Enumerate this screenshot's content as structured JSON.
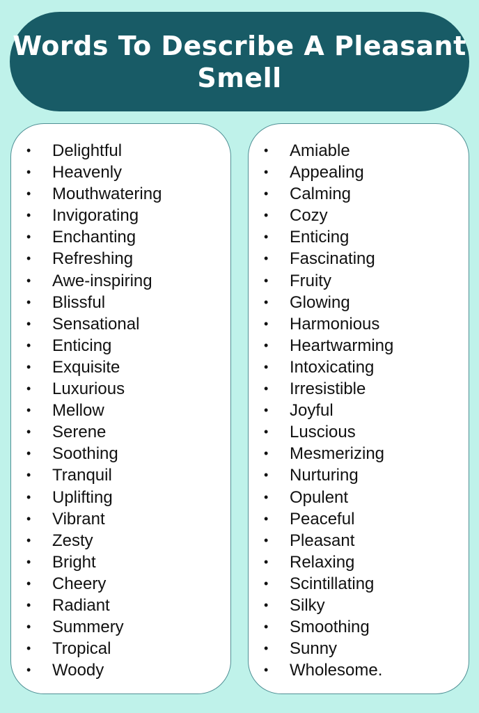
{
  "title": "Words To Describe A Pleasant Smell",
  "colors": {
    "background": "#bff2ea",
    "header": "#185b66",
    "card": "#ffffff",
    "text": "#111111"
  },
  "bullet_glyph": "•",
  "columns": [
    {
      "items": [
        "Delightful",
        "Heavenly",
        "Mouthwatering",
        "Invigorating",
        "Enchanting",
        "Refreshing",
        "Awe-inspiring",
        "Blissful",
        "Sensational",
        "Enticing",
        "Exquisite",
        "Luxurious",
        "Mellow",
        "Serene",
        "Soothing",
        "Tranquil",
        "Uplifting",
        "Vibrant",
        "Zesty",
        "Bright",
        "Cheery",
        "Radiant",
        "Summery",
        "Tropical",
        "Woody"
      ]
    },
    {
      "items": [
        "Amiable",
        "Appealing",
        "Calming",
        "Cozy",
        "Enticing",
        "Fascinating",
        "Fruity",
        "Glowing",
        "Harmonious",
        "Heartwarming",
        "Intoxicating",
        "Irresistible",
        "Joyful",
        "Luscious",
        "Mesmerizing",
        "Nurturing",
        "Opulent",
        "Peaceful",
        "Pleasant",
        "Relaxing",
        "Scintillating",
        "Silky",
        "Smoothing",
        "Sunny",
        "Wholesome."
      ]
    }
  ]
}
